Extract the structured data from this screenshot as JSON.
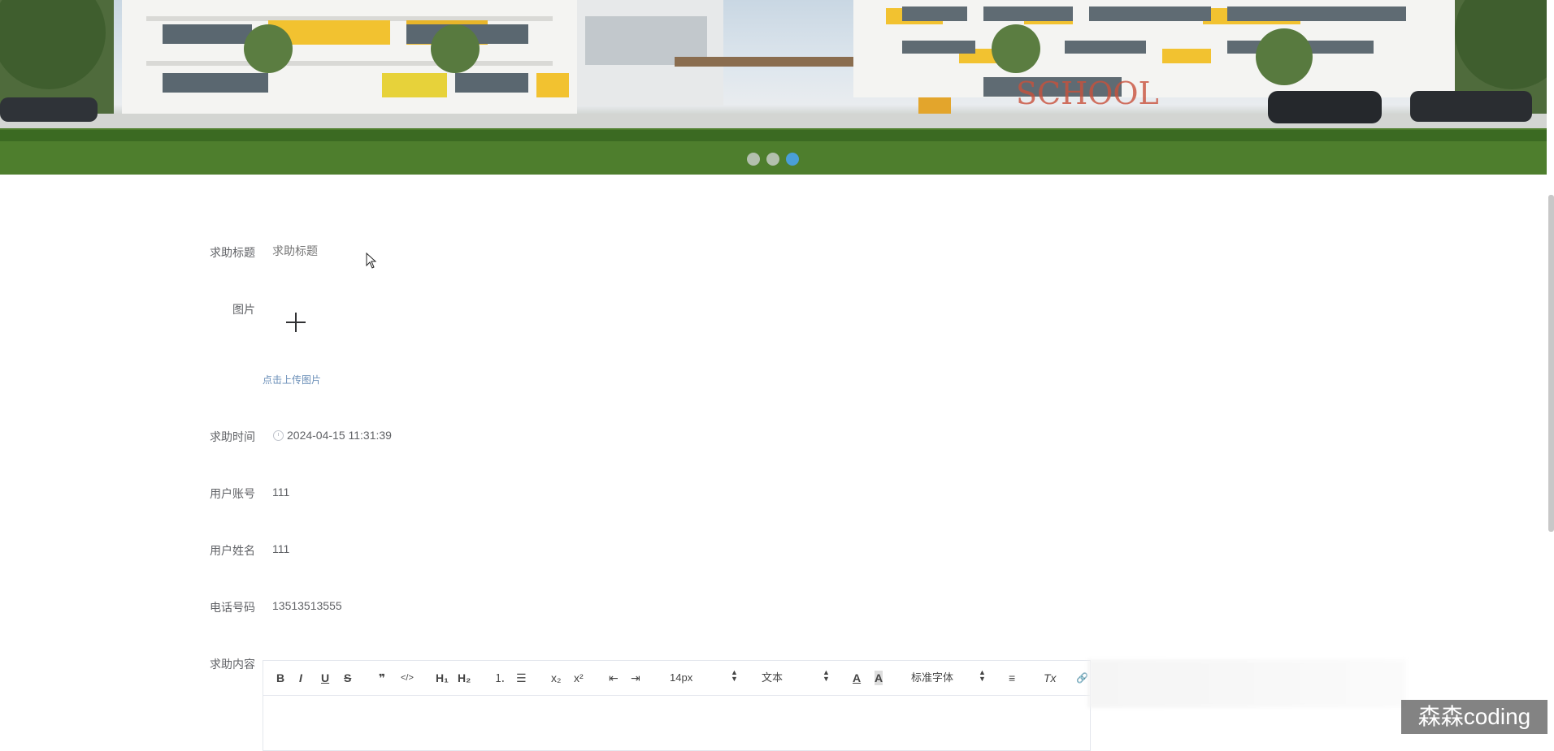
{
  "banner": {
    "dots": [
      {
        "active": false
      },
      {
        "active": false
      },
      {
        "active": true
      }
    ],
    "sign_text": "SCHOOL"
  },
  "form": {
    "title_label": "求助标题",
    "title_placeholder": "求助标题",
    "image_label": "图片",
    "upload_tip": "点击上传图片",
    "time_label": "求助时间",
    "time_value": "2024-04-15 11:31:39",
    "account_label": "用户账号",
    "account_value": "111",
    "name_label": "用户姓名",
    "name_value": "111",
    "phone_label": "电话号码",
    "phone_value": "13513513555",
    "content_label": "求助内容"
  },
  "editor": {
    "toolbar": {
      "bold": "B",
      "italic": "I",
      "underline": "U",
      "strike": "S",
      "quote": "❞",
      "code": "</>",
      "h1": "H₁",
      "h2": "H₂",
      "ordered_list": "⒈",
      "bullet_list": "☰",
      "subscript": "x₂",
      "superscript": "x²",
      "outdent": "⇤",
      "indent": "⇥",
      "size_value": "14px",
      "header_value": "文本",
      "font_value": "标准字体",
      "align": "≡",
      "clean": "Tx",
      "link": "🔗"
    }
  },
  "watermark": "森森coding"
}
